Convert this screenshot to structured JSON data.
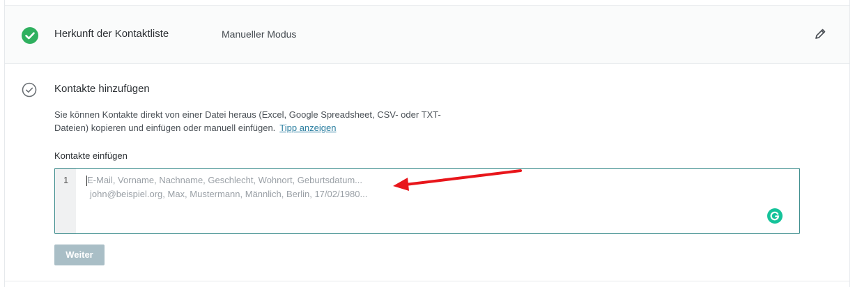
{
  "step1": {
    "title": "Herkunft der Kontaktliste",
    "mode": "Manueller Modus",
    "status_icon": "check-circle-green",
    "edit_icon": "pencil-icon"
  },
  "step2": {
    "title": "Kontakte hinzufügen",
    "status_icon": "check-circle-outline",
    "description": "Sie können Kontakte direkt von einer Datei heraus (Excel, Google Spreadsheet, CSV- oder TXT-Dateien) kopieren und einfügen oder manuell einfügen.",
    "tip_link": "Tipp anzeigen",
    "field_label": "Kontakte einfügen",
    "editor": {
      "line_number": "1",
      "placeholder_line1": "E-Mail, Vorname, Nachname, Geschlecht, Wohnort, Geburtsdatum...",
      "placeholder_line2": "john@beispiel.org, Max, Mustermann, Männlich, Berlin, 17/02/1980..."
    },
    "next_button": "Weiter"
  },
  "colors": {
    "success_green": "#2fb05f",
    "editor_border": "#3a8b8b",
    "button_disabled": "#a9bec6",
    "annotation_arrow": "#e8161b",
    "grammarly": "#15c39a"
  }
}
